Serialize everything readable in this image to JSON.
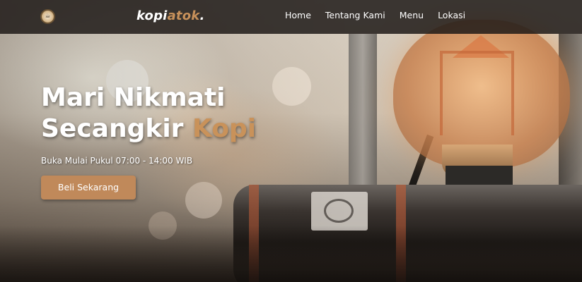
{
  "navbar": {
    "brand_main": "kopi",
    "brand_accent": "atok",
    "brand_dot": ".",
    "links": [
      {
        "label": "Home"
      },
      {
        "label": "Tentang Kami"
      },
      {
        "label": "Menu"
      },
      {
        "label": "Lokasi"
      }
    ]
  },
  "hero": {
    "headline_line1": "Mari Nikmati",
    "headline_line2_prefix": "Secangkir ",
    "headline_line2_accent": "Kopi",
    "subtext": "Buka Mulai Pukul 07:00 - 14:00 WIB",
    "cta_label": "Beli Sekarang"
  },
  "colors": {
    "accent": "#c8915a",
    "navbar_bg": "#1e1a17",
    "cta_bg": "#c0895a",
    "text": "#ffffff"
  },
  "icons": {
    "logo": "coffee-logo-icon"
  }
}
